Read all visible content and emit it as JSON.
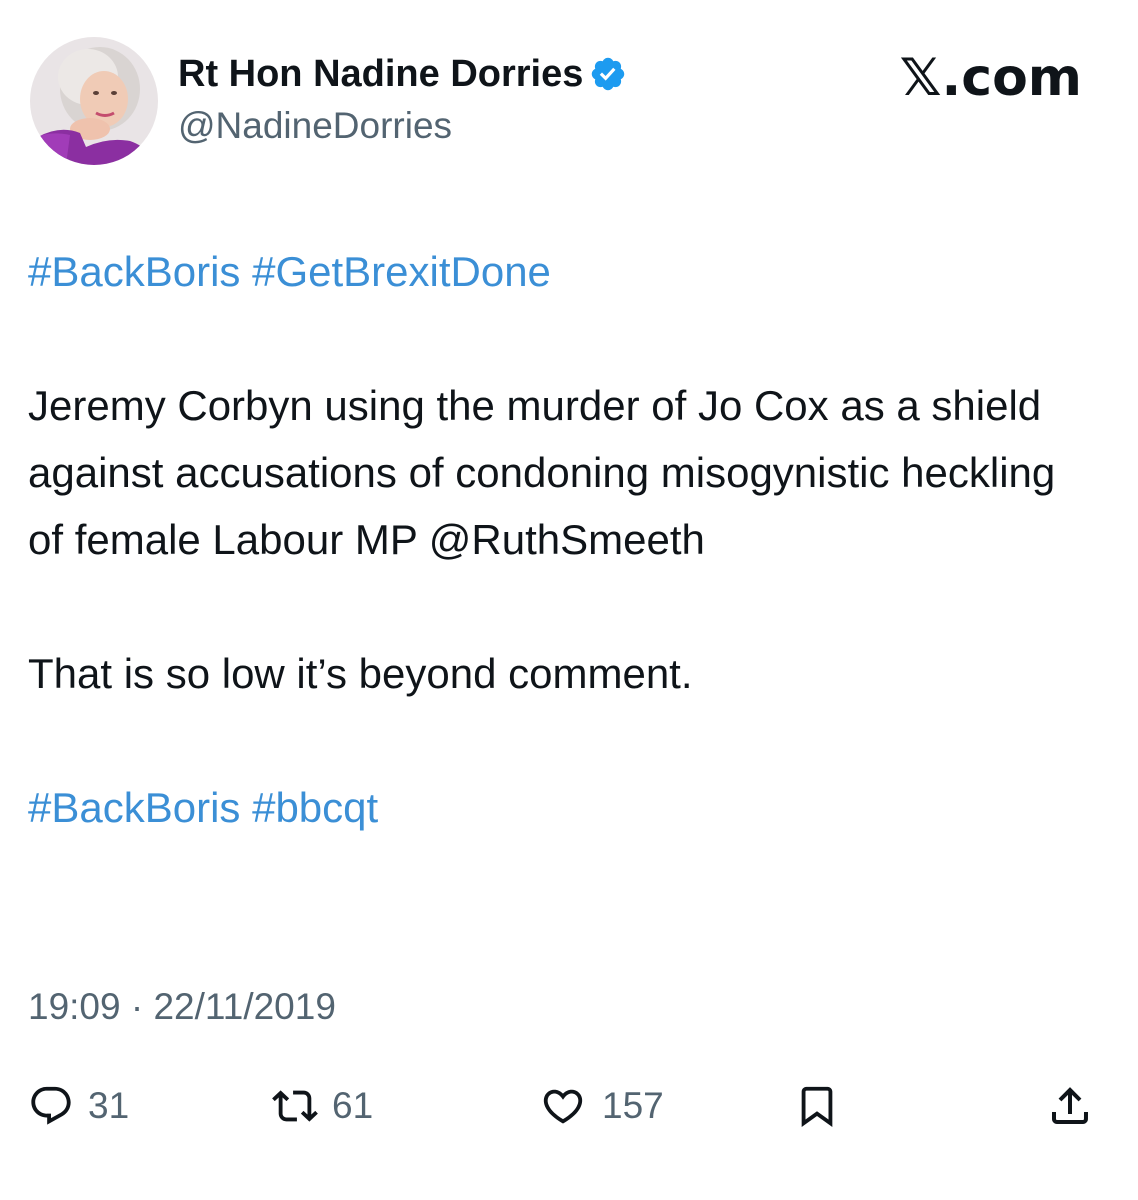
{
  "author": {
    "display_name": "Rt Hon Nadine Dorries",
    "handle": "@NadineDorries",
    "avatar_icon": "profile-photo",
    "verified_icon": "verified-badge-icon"
  },
  "site_logo": "𝕏.com",
  "tweet": {
    "line1_hashtags": [
      "#BackBoris",
      "#GetBrexitDone"
    ],
    "paragraph1": "Jeremy Corbyn using the murder of Jo Cox as a shield against accusations of condoning misogynistic heckling of female Labour MP @RuthSmeeth",
    "paragraph2": "That is so low it’s beyond comment.",
    "line4_hashtags": [
      "#BackBoris",
      "#bbcqt"
    ]
  },
  "timestamp": "19:09 · 22/11/2019",
  "actions": {
    "replies": "31",
    "retweets": "61",
    "likes": "157"
  },
  "colors": {
    "link": "#3b8fd6",
    "secondary_text": "#536471",
    "primary_text": "#0f1419",
    "verified": "#1d9bf0"
  }
}
